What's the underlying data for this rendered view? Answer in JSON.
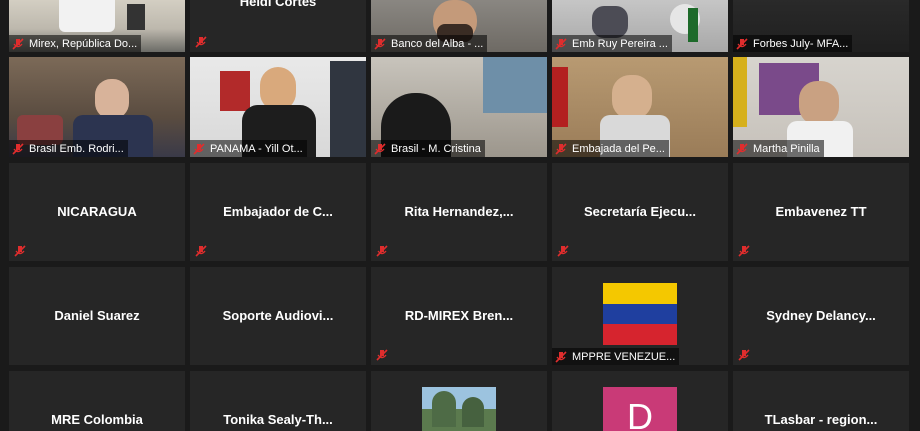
{
  "colors": {
    "tile_bg": "#262626",
    "active_border": "#b6d94a",
    "mute_icon": "#e02d2d",
    "venezuela_flag": [
      "#f4c800",
      "#1f3f9f",
      "#d6242e"
    ],
    "avatar_bg": "#c93a77"
  },
  "row1": [
    {
      "label": "Mirex, República Do...",
      "muted": true,
      "active": true
    },
    {
      "center": "Heidi Cortes",
      "muted": true
    },
    {
      "label": "Banco del Alba - ...",
      "muted": true
    },
    {
      "label": "Emb Ruy Pereira ...",
      "muted": true
    },
    {
      "label": "Forbes July- MFA...",
      "muted": true
    }
  ],
  "row2": [
    {
      "label": "Brasil Emb. Rodri...",
      "muted": true
    },
    {
      "label": "PANAMA - Yill Ot...",
      "muted": true
    },
    {
      "label": "Brasil - M. Cristina",
      "muted": true
    },
    {
      "label": "Embajada del Pe...",
      "muted": true
    },
    {
      "label": "Martha Pinilla",
      "muted": true
    }
  ],
  "row3": [
    {
      "center": "NICARAGUA"
    },
    {
      "center": "Embajador de C..."
    },
    {
      "center": "Rita Hernandez,..."
    },
    {
      "center": "Secretaría Ejecu..."
    },
    {
      "center": "Embavenez TT"
    }
  ],
  "row4": [
    {
      "center": "Daniel Suarez"
    },
    {
      "center": "Soporte Audiovi..."
    },
    {
      "center": "RD-MIREX Bren..."
    },
    {
      "label": "MPPRE VENEZUE...",
      "icon": "venezuela-flag-avatar"
    },
    {
      "center": "Sydney Delancy..."
    }
  ],
  "row5": [
    {
      "center": "MRE Colombia"
    },
    {
      "center": "Tonika Sealy-Th..."
    },
    {
      "icon": "landscape-avatar"
    },
    {
      "avatar_letter": "D"
    },
    {
      "center": "TLasbar - region..."
    }
  ]
}
